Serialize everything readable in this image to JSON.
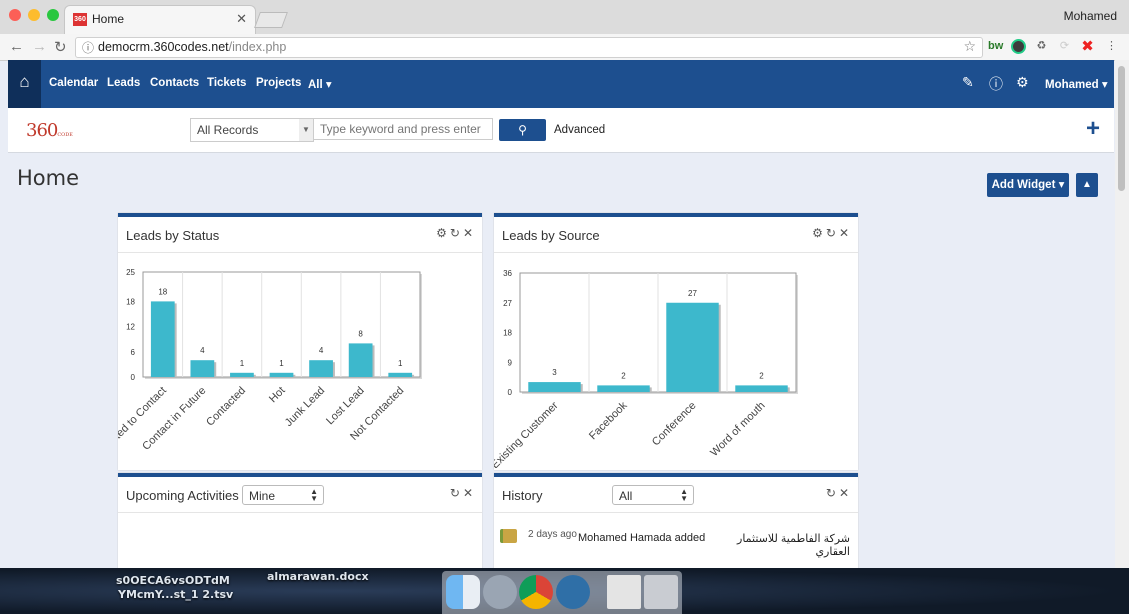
{
  "browser": {
    "tab_title": "Home",
    "favicon": "360",
    "user": "Mohamed",
    "url_host": "democrm.360codes.net",
    "url_path": "/index.php"
  },
  "nav": {
    "items": [
      "Calendar",
      "Leads",
      "Contacts",
      "Tickets",
      "Projects",
      "All ▾"
    ],
    "user": "Mohamed ▾"
  },
  "search": {
    "logo": "360",
    "logo_sub": "CODE",
    "scope": "All Records",
    "placeholder": "Type keyword and press enter",
    "advanced": "Advanced"
  },
  "page": {
    "title": "Home",
    "add_widget": "Add Widget ▾"
  },
  "widgets": {
    "leads_status": {
      "title": "Leads by Status"
    },
    "leads_source": {
      "title": "Leads by Source"
    },
    "activities": {
      "title": "Upcoming Activities",
      "filter": "Mine"
    },
    "history": {
      "title": "History",
      "filter": "All",
      "entry_time": "2 days ago",
      "entry_text": "Mohamed Hamada added",
      "entry_rtl": "شركة الفاطمية للاستثمار العقاري"
    }
  },
  "desktop": {
    "file1": "s0OECA6vsODTdM",
    "file1b": "YMcmY...st_1 2.tsv",
    "file2": "almarawan.docx"
  },
  "colors": {
    "primary": "#1d4f8f",
    "bar": "#3db8cc",
    "accent_red": "#c0392b"
  },
  "chart_data": [
    {
      "type": "bar",
      "title": "Leads by Status",
      "categories": [
        "Attempted to Contact",
        "Contact in Future",
        "Contacted",
        "Hot",
        "Junk Lead",
        "Lost Lead",
        "Not Contacted"
      ],
      "values": [
        18,
        4,
        1,
        1,
        4,
        8,
        1
      ],
      "ylim": [
        0,
        25
      ],
      "yticks": [
        0,
        6,
        12,
        18,
        25
      ]
    },
    {
      "type": "bar",
      "title": "Leads by Source",
      "categories": [
        "Existing Customer",
        "Facebook",
        "Conference",
        "Word of mouth"
      ],
      "values": [
        3,
        2,
        27,
        2
      ],
      "ylim": [
        0,
        36
      ],
      "yticks": [
        0,
        9,
        18,
        27,
        36
      ]
    }
  ]
}
